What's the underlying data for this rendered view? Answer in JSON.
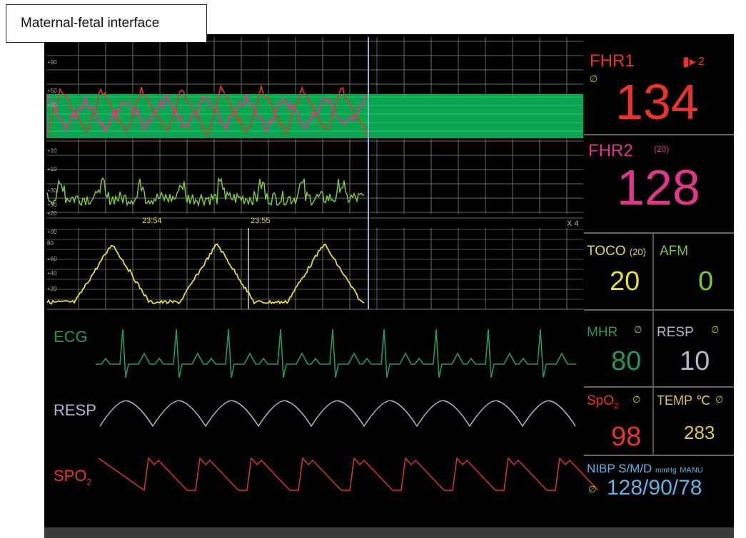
{
  "caption": "Maternal-fetal interface",
  "trend": {
    "fhr_ticks": [
      "+90",
      "+50",
      "+30",
      "+10",
      "+10",
      "+30",
      "+50",
      "+20"
    ],
    "times": [
      "23:54",
      "23:55"
    ],
    "speed": "X 4",
    "toco_ticks": [
      "+00",
      "80",
      "+60",
      "+40",
      "+20"
    ]
  },
  "waves": {
    "ecg": "ECG",
    "resp": "RESP",
    "spo2_main": "SPO",
    "spo2_sub": "2"
  },
  "params": {
    "fhr1": {
      "label": "FHR1",
      "value": "134",
      "vol": "2"
    },
    "fhr2": {
      "label": "FHR2",
      "sub": "(20)",
      "value": "128"
    },
    "toco": {
      "label": "TOCO",
      "sub": "(20)",
      "value": "20"
    },
    "afm": {
      "label": "AFM",
      "value": "0"
    },
    "mhr": {
      "label": "MHR",
      "value": "80"
    },
    "resp": {
      "label": "RESP",
      "value": "10"
    },
    "spo2": {
      "label": "SpO",
      "sub": "2",
      "value": "98"
    },
    "temp": {
      "label": "TEMP",
      "unit": "℃",
      "value": "283"
    },
    "nibp": {
      "label": "NIBP",
      "mode": "S/M/D",
      "unit": "mmHg",
      "manu": "MANU",
      "value": "128/90/78"
    }
  },
  "colors": {
    "fhr1": "#e8342c",
    "fhr2": "#e0378a",
    "toco": "#e6dc3c",
    "afm": "#7ac83c",
    "mhr": "#1f9a5a",
    "resp": "#b4b4d2",
    "spo2": "#e8342c",
    "temp": "#e6c83c",
    "nibp": "#5fb4e6"
  }
}
